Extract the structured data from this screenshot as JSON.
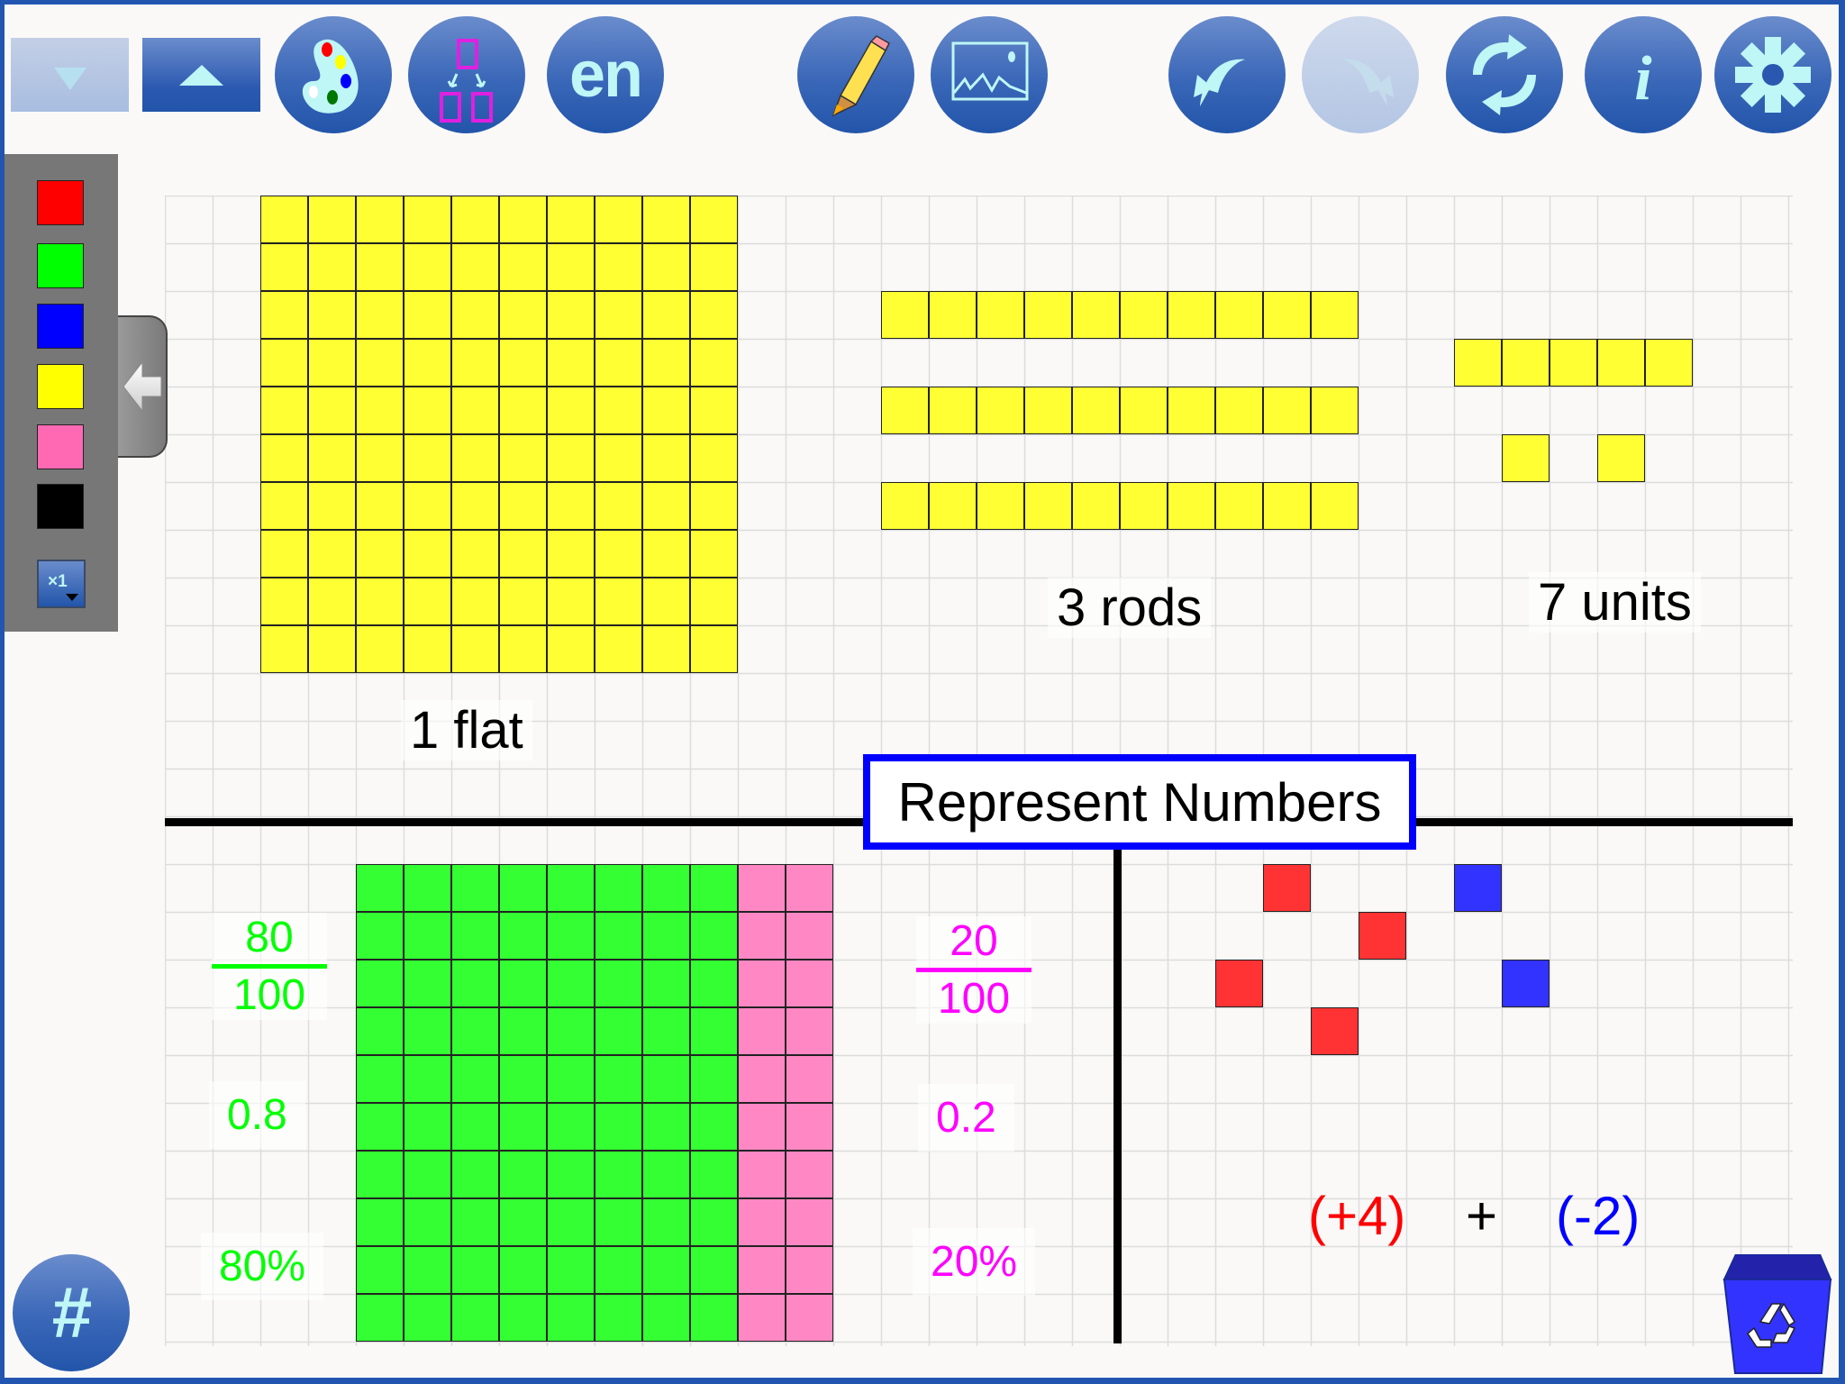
{
  "toolbar": {
    "buttons": [
      {
        "name": "scroll-down",
        "icon": "chevron-down-icon",
        "enabled": false
      },
      {
        "name": "scroll-up",
        "icon": "chevron-up-icon",
        "enabled": true
      },
      {
        "name": "color-palette",
        "icon": "palette-icon",
        "enabled": true
      },
      {
        "name": "decompose",
        "icon": "split-icon",
        "enabled": true
      },
      {
        "name": "language",
        "label": "en",
        "enabled": true
      },
      {
        "name": "draw",
        "icon": "pencil-icon",
        "enabled": true
      },
      {
        "name": "background",
        "icon": "image-icon",
        "enabled": true
      },
      {
        "name": "undo",
        "icon": "undo-icon",
        "enabled": true
      },
      {
        "name": "redo",
        "icon": "redo-icon",
        "enabled": false
      },
      {
        "name": "reset",
        "icon": "refresh-icon",
        "enabled": true
      },
      {
        "name": "info",
        "icon": "info-icon",
        "enabled": true
      },
      {
        "name": "settings",
        "icon": "gear-icon",
        "enabled": true
      }
    ],
    "language_label": "en"
  },
  "palette": {
    "colors": [
      "#ff0000",
      "#00ff00",
      "#0000ff",
      "#ffff00",
      "#ff69b4",
      "#000000"
    ],
    "multiplier_label": "×1"
  },
  "canvas": {
    "title": "Represent Numbers",
    "colors": {
      "unit_yellow": "#ffff33",
      "green": "#33ff33",
      "pink": "#ff88c4",
      "red_tile": "#ff3333",
      "blue_tile": "#3333ff"
    },
    "top": {
      "flat": {
        "count": 1,
        "rows": 10,
        "cols": 10
      },
      "rods": {
        "count": 3,
        "length": 10
      },
      "units": {
        "count": 7
      },
      "labels": {
        "flat": "1 flat",
        "rods": "3 rods",
        "units": "7 units"
      }
    },
    "bottom_left": {
      "hundred_grid": {
        "rows": 10,
        "green_cols": 8,
        "pink_cols": 2
      },
      "green": {
        "numerator": "80",
        "denominator": "100",
        "decimal": "0.8",
        "percent": "80%",
        "color": "#00ff00"
      },
      "pink": {
        "numerator": "20",
        "denominator": "100",
        "decimal": "0.2",
        "percent": "20%",
        "color": "#ff00ff"
      }
    },
    "bottom_right": {
      "positive_tiles": 4,
      "negative_tiles": 2,
      "expression": {
        "left": "(+4)",
        "op": "+",
        "right": "(-2)",
        "left_color": "#ff0000",
        "right_color": "#0000ff"
      }
    }
  },
  "footer": {
    "grid_toggle_label": "#",
    "trash": "recycle-bin"
  }
}
